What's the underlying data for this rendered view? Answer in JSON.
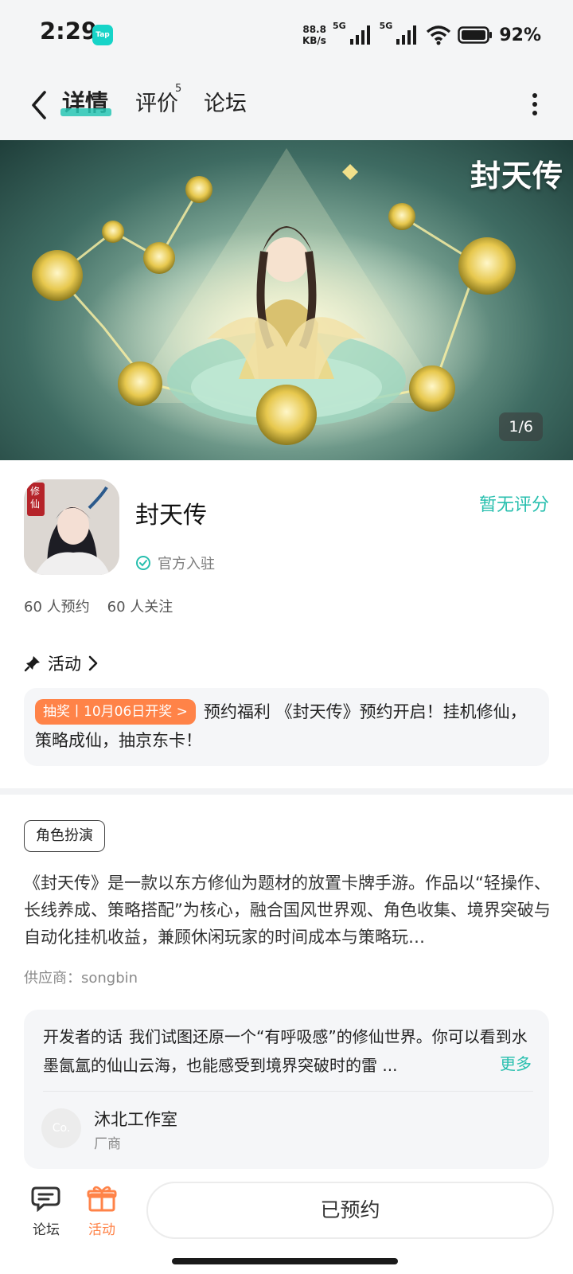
{
  "status_bar": {
    "time": "2:29",
    "tap_badge": "Tap",
    "net_speed_value": "88.8",
    "net_speed_unit": "KB/s",
    "net1": "5G",
    "net2": "5G",
    "battery": "92%"
  },
  "nav": {
    "tabs": [
      {
        "label": "详情",
        "active": true
      },
      {
        "label": "评价",
        "badge": "5"
      },
      {
        "label": "论坛"
      }
    ]
  },
  "banner": {
    "logo_text": "封天传",
    "counter": "1/6"
  },
  "app": {
    "icon_badge": "修仙",
    "name": "封天传",
    "rating_text": "暂无评分",
    "official_label": "官方入驻",
    "reservations": "60 人预约",
    "followers": "60 人关注"
  },
  "activity": {
    "title": "活动",
    "badge": "抽奖丨10月06日开奖 >",
    "text": "预约福利 《封天传》预约开启！挂机修仙，策略成仙，抽京东卡！"
  },
  "detail": {
    "tag": "角色扮演",
    "description": "《封天传》是一款以东方修仙为题材的放置卡牌手游。作品以“轻操作、长线养成、策略搭配”为核心，融合国风世界观、角色收集、境界突破与自动化挂机收益，兼顾休闲玩家的时间成本与策略玩…",
    "supplier": "供应商：songbin"
  },
  "developer": {
    "label": "开发者的话",
    "text": "我们试图还原一个“有呼吸感”的修仙世界。你可以看到水墨氤氲的仙山云海，也能感受到境界突破时的雷 ...",
    "more": "更多",
    "avatar_text": "Co.",
    "name": "沐北工作室",
    "role": "厂商"
  },
  "bottom": {
    "forum_label": "论坛",
    "activity_label": "活动",
    "reserve_button": "已预约"
  },
  "colors": {
    "accent": "#27bfae",
    "orange": "#ff8348"
  }
}
